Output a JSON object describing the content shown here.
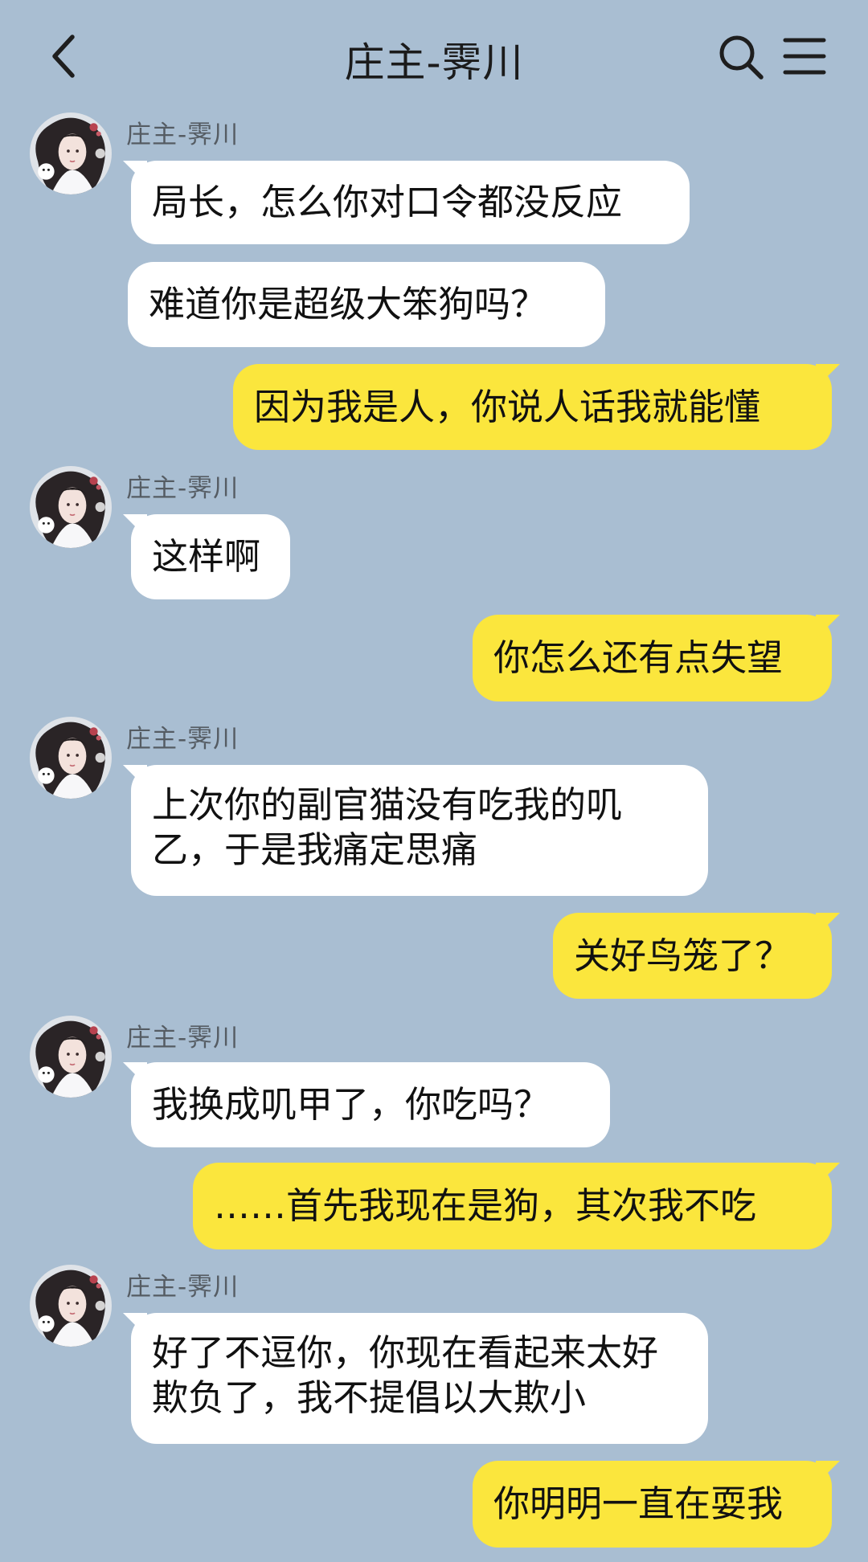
{
  "header": {
    "title": "庄主-霁川",
    "back_icon": "chevron-left-icon",
    "search_icon": "search-icon",
    "menu_icon": "menu-icon"
  },
  "colors": {
    "background": "#a9bed2",
    "incoming_bubble": "#ffffff",
    "outgoing_bubble": "#fbe63d"
  },
  "messages": [
    {
      "from": "other",
      "sender": "庄主-霁川",
      "text": "局长，怎么你对口令都没反应"
    },
    {
      "from": "other",
      "text": "难道你是超级大笨狗吗？"
    },
    {
      "from": "me",
      "text": "因为我是人，你说人话我就能懂"
    },
    {
      "from": "other",
      "sender": "庄主-霁川",
      "text": "这样啊"
    },
    {
      "from": "me",
      "text": "你怎么还有点失望"
    },
    {
      "from": "other",
      "sender": "庄主-霁川",
      "text": "上次你的副官猫没有吃我的叽乙，于是我痛定思痛"
    },
    {
      "from": "me",
      "text": "关好鸟笼了？"
    },
    {
      "from": "other",
      "sender": "庄主-霁川",
      "text": "我换成叽甲了，你吃吗？"
    },
    {
      "from": "me",
      "text": "……首先我现在是狗，其次我不吃"
    },
    {
      "from": "other",
      "sender": "庄主-霁川",
      "text": "好了不逗你，你现在看起来太好欺负了，我不提倡以大欺小"
    },
    {
      "from": "me",
      "text": "你明明一直在耍我"
    }
  ]
}
